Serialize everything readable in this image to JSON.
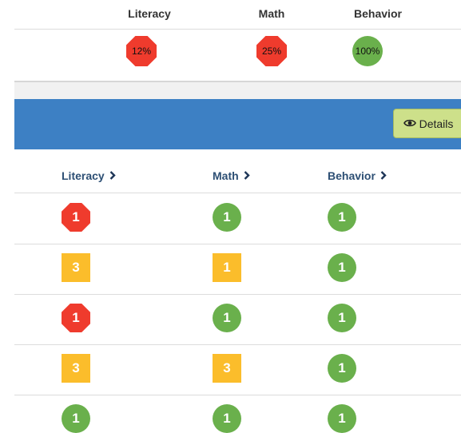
{
  "summary": {
    "headers": [
      "Literacy",
      "Math",
      "Behavior"
    ],
    "values": [
      {
        "text": "12%",
        "status": "red"
      },
      {
        "text": "25%",
        "status": "red"
      },
      {
        "text": "100%",
        "status": "green"
      }
    ]
  },
  "toolbar": {
    "details_label": "Details",
    "details_icon": "eye-icon"
  },
  "table": {
    "columns": [
      "Literacy",
      "Math",
      "Behavior"
    ],
    "rows": [
      [
        {
          "value": "1",
          "status": "red"
        },
        {
          "value": "1",
          "status": "green"
        },
        {
          "value": "1",
          "status": "green"
        }
      ],
      [
        {
          "value": "3",
          "status": "yellow"
        },
        {
          "value": "1",
          "status": "yellow"
        },
        {
          "value": "1",
          "status": "green"
        }
      ],
      [
        {
          "value": "1",
          "status": "red"
        },
        {
          "value": "1",
          "status": "green"
        },
        {
          "value": "1",
          "status": "green"
        }
      ],
      [
        {
          "value": "3",
          "status": "yellow"
        },
        {
          "value": "3",
          "status": "yellow"
        },
        {
          "value": "1",
          "status": "green"
        }
      ],
      [
        {
          "value": "1",
          "status": "green"
        },
        {
          "value": "1",
          "status": "green"
        },
        {
          "value": "1",
          "status": "green"
        }
      ]
    ]
  },
  "colors": {
    "red": "#ef3b2d",
    "green": "#6ab04c",
    "yellow": "#fbbd2b",
    "bar": "#3d80c4",
    "button": "#cde08a"
  }
}
